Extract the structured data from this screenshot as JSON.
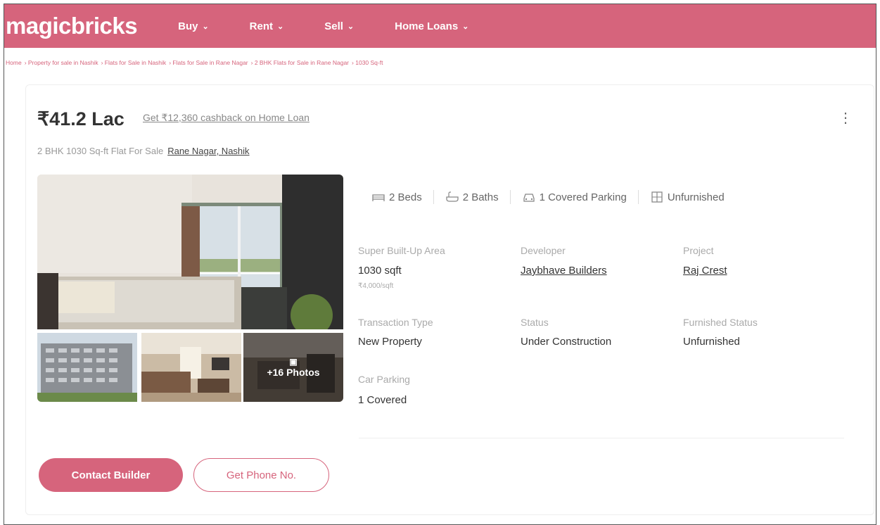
{
  "header": {
    "logo": "magicbricks",
    "nav": [
      {
        "label": "Buy"
      },
      {
        "label": "Rent"
      },
      {
        "label": "Sell"
      },
      {
        "label": "Home Loans"
      }
    ]
  },
  "breadcrumb": [
    "Home",
    "Property for sale in Nashik",
    "Flats for Sale in Nashik",
    "Flats for Sale in Rane Nagar",
    "2 BHK Flats for Sale in Rane Nagar",
    "1030 Sq-ft"
  ],
  "listing": {
    "price": "₹41.2 Lac",
    "cashback": "Get ₹12,360 cashback on Home Loan",
    "subtitle": "2 BHK 1030 Sq-ft Flat For Sale",
    "location": "Rane Nagar, Nashik",
    "photos_more": "+16 Photos",
    "features": {
      "beds": "2 Beds",
      "baths": "2 Baths",
      "parking": "1 Covered Parking",
      "furnishing": "Unfurnished"
    },
    "details": {
      "area_label": "Super Built-Up Area",
      "area_value": "1030 sqft",
      "area_rate": "₹4,000/sqft",
      "developer_label": "Developer",
      "developer_value": "Jaybhave Builders",
      "project_label": "Project",
      "project_value": "Raj Crest",
      "transaction_label": "Transaction Type",
      "transaction_value": "New Property",
      "status_label": "Status",
      "status_value": "Under Construction",
      "furnished_label": "Furnished Status",
      "furnished_value": "Unfurnished",
      "car_parking_label": "Car Parking",
      "car_parking_value": "1 Covered"
    }
  },
  "actions": {
    "contact": "Contact Builder",
    "phone": "Get Phone No."
  },
  "colors": {
    "brand": "#d6647c"
  }
}
